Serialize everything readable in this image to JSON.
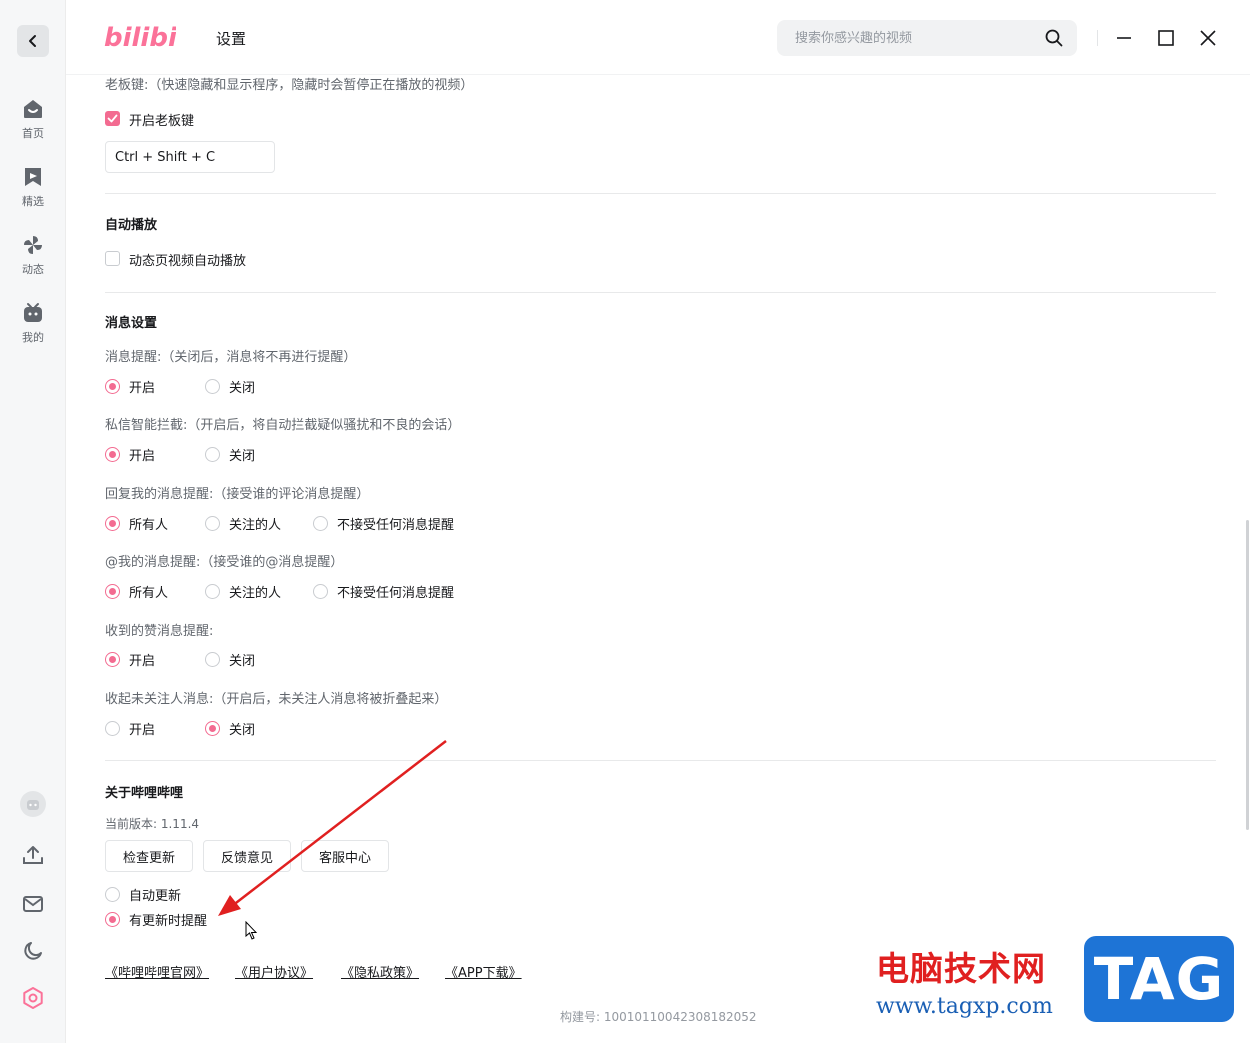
{
  "colors": {
    "accent": "#f36b91",
    "brand_pink": "#fb7299"
  },
  "sidebar": {
    "items": [
      {
        "icon": "home-icon",
        "label": "首页"
      },
      {
        "icon": "bookmark-icon",
        "label": "精选"
      },
      {
        "icon": "pinwheel-icon",
        "label": "动态"
      },
      {
        "icon": "tv-icon",
        "label": "我的"
      }
    ],
    "bottom_icons": [
      "avatar-icon",
      "upload-icon",
      "mail-icon",
      "moon-icon",
      "settings-icon"
    ]
  },
  "header": {
    "logo_text": "bilibili",
    "title": "设置",
    "search_placeholder": "搜索你感兴趣的视频"
  },
  "boss_key": {
    "label": "老板键:（快速隐藏和显示程序，隐藏时会暂停正在播放的视频）",
    "checkbox_label": "开启老板键",
    "checked": true,
    "hotkey_value": "Ctrl + Shift + C"
  },
  "autoplay": {
    "heading": "自动播放",
    "checkbox_label": "动态页视频自动播放",
    "checked": false
  },
  "messages": {
    "heading": "消息设置",
    "groups": [
      {
        "label": "消息提醒:（关闭后，消息将不再进行提醒）",
        "options": [
          "开启",
          "关闭"
        ],
        "selected": 0
      },
      {
        "label": "私信智能拦截:（开启后，将自动拦截疑似骚扰和不良的会话）",
        "options": [
          "开启",
          "关闭"
        ],
        "selected": 0
      },
      {
        "label": "回复我的消息提醒:（接受谁的评论消息提醒）",
        "options": [
          "所有人",
          "关注的人",
          "不接受任何消息提醒"
        ],
        "selected": 0
      },
      {
        "label": "@我的消息提醒:（接受谁的@消息提醒）",
        "options": [
          "所有人",
          "关注的人",
          "不接受任何消息提醒"
        ],
        "selected": 0
      },
      {
        "label": "收到的赞消息提醒:",
        "options": [
          "开启",
          "关闭"
        ],
        "selected": 0
      },
      {
        "label": "收起未关注人消息:（开启后，未关注人消息将被折叠起来）",
        "options": [
          "开启",
          "关闭"
        ],
        "selected": 1
      }
    ]
  },
  "about": {
    "heading": "关于哔哩哔哩",
    "version": "当前版本: 1.11.4",
    "buttons": [
      "检查更新",
      "反馈意见",
      "客服中心"
    ],
    "update_options": [
      "自动更新",
      "有更新时提醒"
    ],
    "update_selected": 1,
    "links": [
      "《哔哩哔哩官网》",
      "《用户协议》",
      "《隐私政策》",
      "《APP下载》"
    ],
    "build": "构建号: 10010110042308182052"
  },
  "watermark": {
    "title": "电脑技术网",
    "url": "www.tagxp.com",
    "badge": "TAG"
  }
}
